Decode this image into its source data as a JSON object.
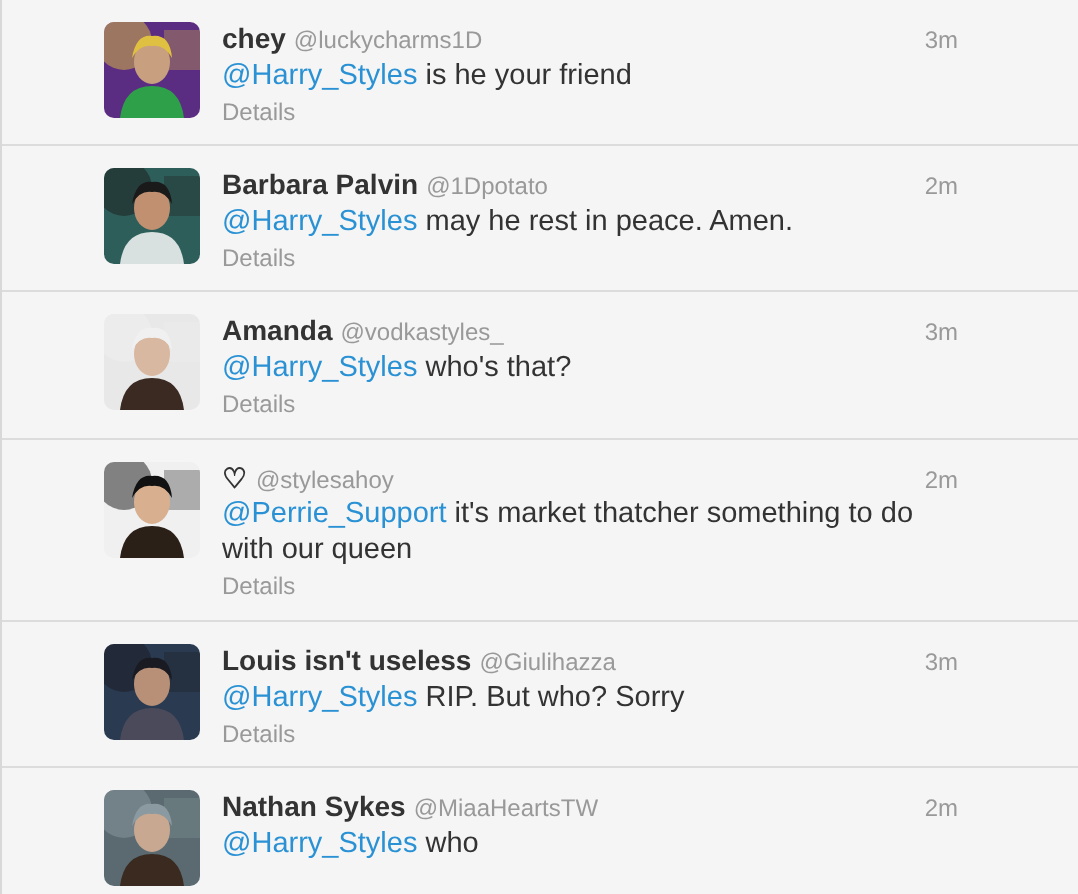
{
  "tweets": [
    {
      "name": "chey",
      "handle": "@luckycharms1D",
      "time": "3m",
      "mention": "@Harry_Styles",
      "text": " is he your friend",
      "details": "Details"
    },
    {
      "name": "Barbara Palvin",
      "handle": "@1Dpotato",
      "time": "2m",
      "mention": "@Harry_Styles",
      "text": " may he rest in peace. Amen.",
      "details": "Details"
    },
    {
      "name": "Amanda",
      "handle": "@vodkastyles_",
      "time": "3m",
      "mention": "@Harry_Styles",
      "text": " who's that?",
      "details": "Details"
    },
    {
      "name": "♡",
      "handle": "@stylesahoy",
      "time": "2m",
      "mention": "@Perrie_Support",
      "text": " it's market thatcher something to do with our queen",
      "details": "Details"
    },
    {
      "name": "Louis isn't useless",
      "handle": "@Giulihazza",
      "time": "3m",
      "mention": "@Harry_Styles",
      "text": " RIP. But who? Sorry",
      "details": "Details"
    },
    {
      "name": "Nathan Sykes",
      "handle": "@MiaaHeartsTW",
      "time": "2m",
      "mention": "@Harry_Styles",
      "text": " who"
    }
  ]
}
